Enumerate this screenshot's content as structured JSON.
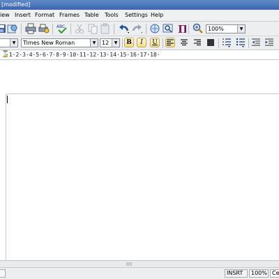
{
  "title_bar": {
    "text": "[modified]"
  },
  "menu": {
    "items": [
      "iew",
      "Insert",
      "Format",
      "Frames",
      "Table",
      "Tools",
      "Settings",
      "Help"
    ]
  },
  "toolbar1": {
    "zoom_value": "100%",
    "icons": [
      "save-icon",
      "export-icon",
      "print-icon",
      "print-preview-icon",
      "spellcheck-icon",
      "cut-icon",
      "copy-icon",
      "paste-icon",
      "undo-icon",
      "redo-icon",
      "link-icon",
      "find-icon",
      "paragraph-marks-icon",
      "zoom-icon"
    ]
  },
  "toolbar2": {
    "font_name": "Times New Roman",
    "font_size": "12",
    "bold_label": "B",
    "italic_label": "I",
    "underline_label": "U"
  },
  "ruler": {
    "text": "·1·2·3·4·5·6·7·8·9·10·11·12·13·14·15·16·17·18·"
  },
  "status_bar": {
    "mode": "INSRT",
    "zoom": "100%",
    "alignment": "Cen"
  },
  "colors": {
    "title_bar": "#4a74b8",
    "toolbar_bg": "#eceef0",
    "active_button": "#f1dc8e"
  }
}
